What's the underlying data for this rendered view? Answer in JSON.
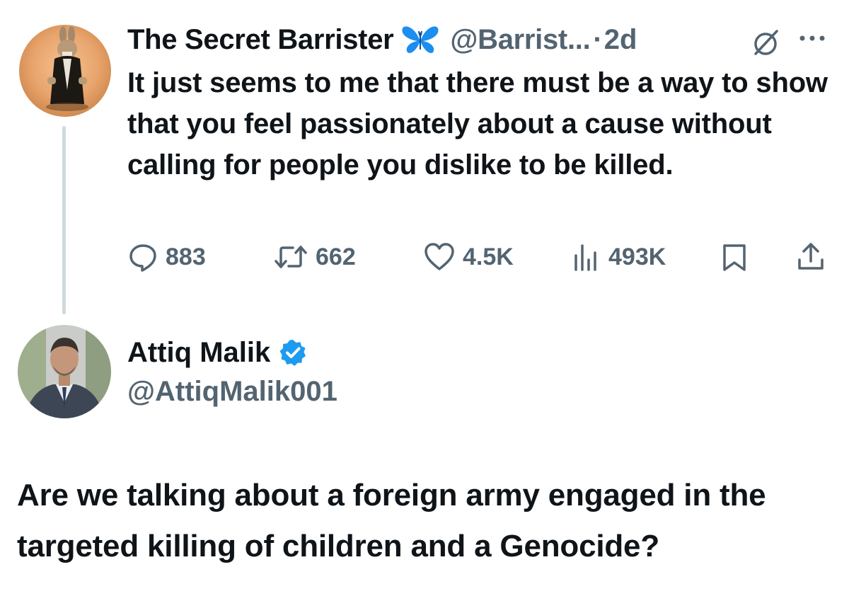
{
  "original_tweet": {
    "author_name": "The Secret Barrister",
    "handle": "@Barrist...",
    "separator": "·",
    "time": "2d",
    "text": "It just seems to me that there must be a way to show that you feel passionately about a cause without calling for people you dislike to be killed.",
    "icons": {
      "badge": "butterfly-icon",
      "grok": "grok-icon",
      "more": "more-icon"
    },
    "metrics": {
      "replies": "883",
      "reposts": "662",
      "likes": "4.5K",
      "views": "493K"
    }
  },
  "reply_tweet": {
    "author_name": "Attiq Malik",
    "handle": "@AttiqMalik001",
    "verified": true,
    "text": "Are we talking about a foreign army engaged in the targeted killing of children and a Genocide?"
  },
  "colors": {
    "text_primary": "#0f1419",
    "text_secondary": "#536471",
    "thread_line": "#cfd9de",
    "verified_blue": "#1d9bf0",
    "butterfly_blue": "#1b8ef0"
  }
}
